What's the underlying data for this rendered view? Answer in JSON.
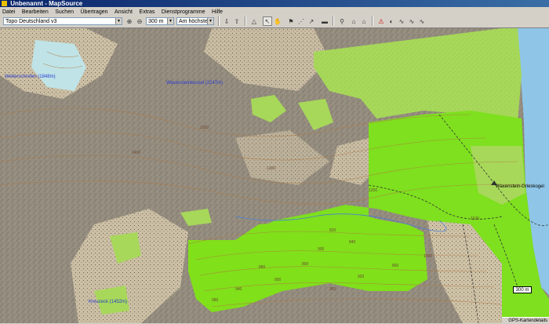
{
  "window": {
    "title": "Unbenannt - MapSource"
  },
  "menu": [
    "Datei",
    "Bearbeiten",
    "Suchen",
    "Übertragen",
    "Ansicht",
    "Extras",
    "Dienstprogramme",
    "Hilfe"
  ],
  "toolbar": {
    "map_product": "Topo Deutschland v3",
    "zoom_scale": "300 m",
    "detail_level": "Am höchsten"
  },
  "map": {
    "labels": [
      {
        "text": "Wetterschrofen (1848m)"
      },
      {
        "text": "Waxensteinkessel (2247m)"
      },
      {
        "text": "Waxenstein-Grieskogel"
      },
      {
        "text": "Kreuzeck (1452m)"
      }
    ],
    "contours": [
      "1500",
      "1400",
      "1300",
      "1200",
      "1100",
      "1000",
      "900",
      "800",
      "820",
      "840",
      "860",
      "880",
      "900",
      "920",
      "940",
      "960",
      "980"
    ],
    "scale_text": "300 m",
    "status_text": "GPS-Kartendetails"
  }
}
